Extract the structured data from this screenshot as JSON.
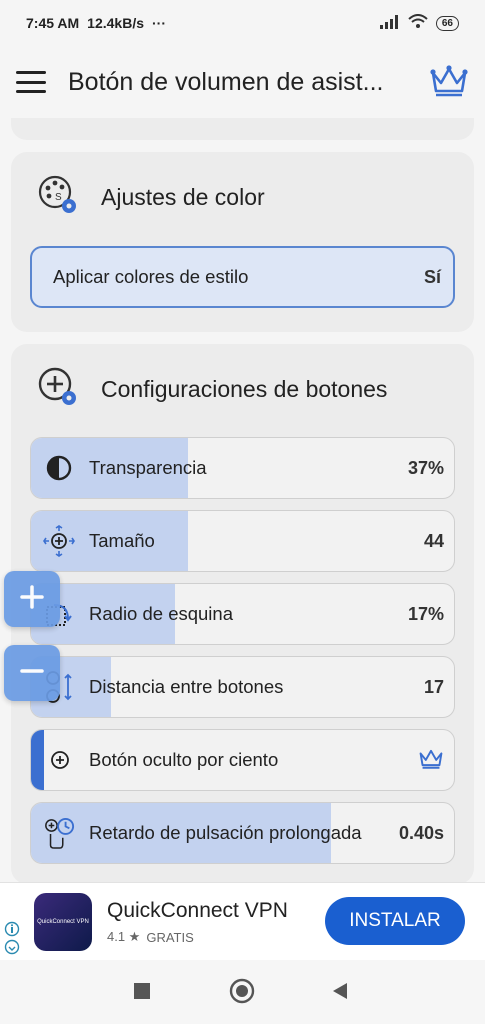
{
  "status_bar": {
    "time": "7:45 AM",
    "speed": "12.4kB/s",
    "dots": "···",
    "battery": "66"
  },
  "app_bar": {
    "title": "Botón de volumen de asist..."
  },
  "color_section": {
    "title": "Ajustes de color",
    "apply_style_label": "Aplicar colores de estilo",
    "apply_style_value": "Sí"
  },
  "buttons_section": {
    "title": "Configuraciones de botones",
    "rows": [
      {
        "label": "Transparencia",
        "value": "37%",
        "fill_fraction": 0.37
      },
      {
        "label": "Tamaño",
        "value": "44",
        "fill_fraction": 0.37
      },
      {
        "label": "Radio de esquina",
        "value": "17%",
        "fill_fraction": 0.34
      },
      {
        "label": "Distancia entre botones",
        "value": "17",
        "fill_fraction": 0.19
      },
      {
        "label": "Botón oculto por ciento",
        "value": "",
        "fill_fraction": 0.03
      },
      {
        "label": "Retardo de pulsación prolongada",
        "value": "0.40s",
        "fill_fraction": 0.71
      }
    ]
  },
  "ad": {
    "name": "QuickConnect VPN",
    "rating": "4.1 ★",
    "tag": "GRATIS",
    "logo_text": "QuickConnect VPN",
    "button": "INSTALAR"
  },
  "colors": {
    "accent": "#5a86d0",
    "fill": "#c3d2ef",
    "ad_button": "#1a5fd0",
    "fab": "#6a9be4"
  }
}
